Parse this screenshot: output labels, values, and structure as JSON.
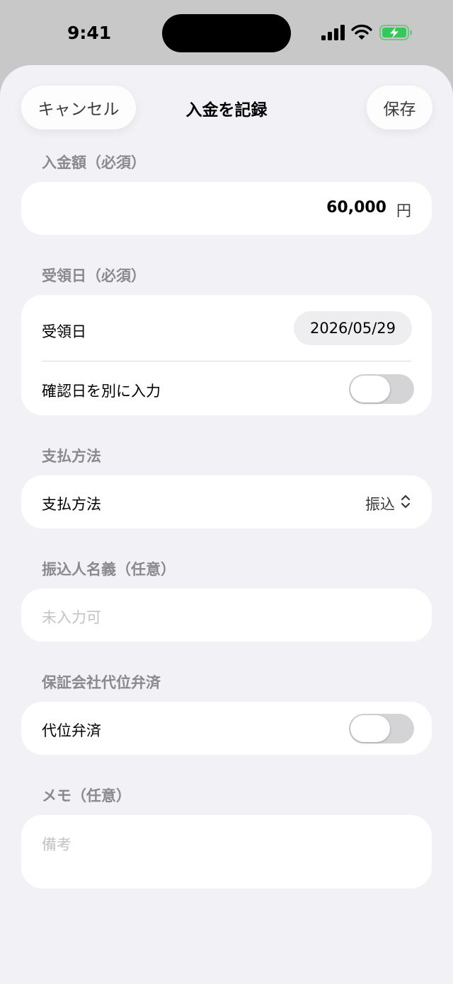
{
  "status_bar": {
    "time": "9:41",
    "icons": [
      "signal-icon",
      "wifi-icon",
      "battery-charging-icon"
    ]
  },
  "nav": {
    "cancel_label": "キャンセル",
    "title": "入金を記録",
    "save_label": "保存"
  },
  "amount_section": {
    "label": "入金額（必須）",
    "value": "60,000",
    "unit": "円"
  },
  "received_section": {
    "label": "受領日（必須）",
    "date_row_label": "受領日",
    "date_value": "2026/05/29",
    "confirm_toggle_label": "確認日を別に入力",
    "confirm_toggle_on": false
  },
  "payment_section": {
    "label": "支払方法",
    "row_label": "支払方法",
    "selected_value": "振込"
  },
  "payer_section": {
    "label": "振込人名義（任意）",
    "placeholder": "未入力可"
  },
  "guarantee_section": {
    "label": "保証会社代位弁済",
    "toggle_label": "代位弁済",
    "toggle_on": false
  },
  "memo_section": {
    "label": "メモ（任意）",
    "placeholder": "備考"
  },
  "colors": {
    "sheet_background": "#f1f1f6",
    "card_background": "#ffffff",
    "section_label": "#8a8a8e",
    "placeholder": "#c3c3c7",
    "battery_charging": "#34c759",
    "toggle_off": "#d4d4d6"
  }
}
